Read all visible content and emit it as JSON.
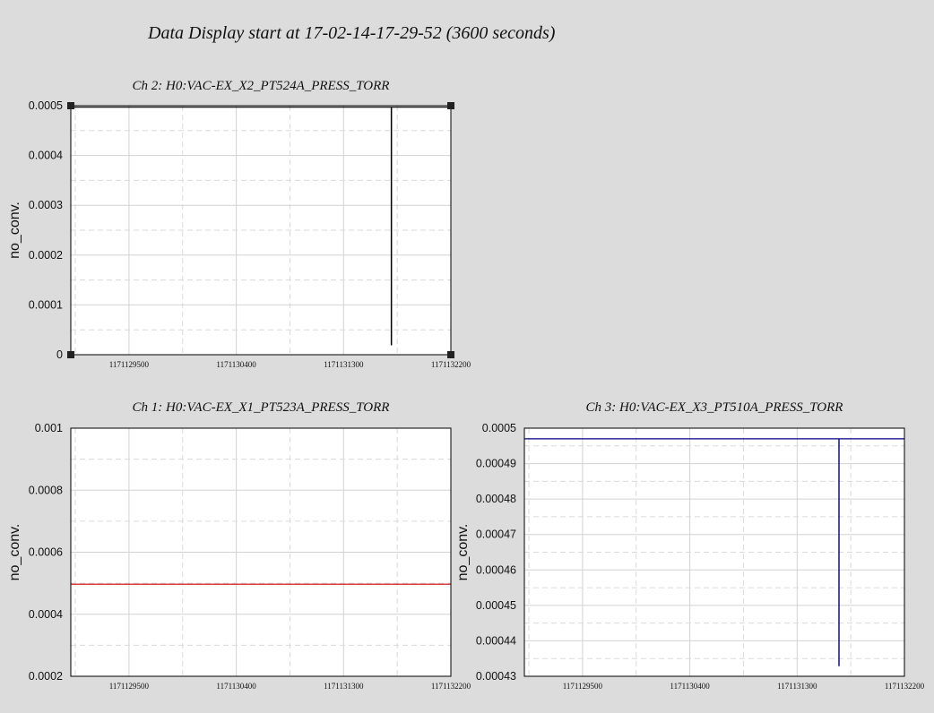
{
  "page": {
    "title": "Data Display start at 17-02-14-17-29-52 (3600 seconds)"
  },
  "chart_data": [
    {
      "id": "ch2",
      "type": "line",
      "title": "Ch 2: H0:VAC-EX_X2_PT524A_PRESS_TORR",
      "xlabel": "",
      "ylabel": "no_conv.",
      "xlim": [
        1171129012,
        1171132200
      ],
      "ylim": [
        0,
        0.0005
      ],
      "xticks": [
        1171129500,
        1171130400,
        1171131300,
        1171132200
      ],
      "xtick_labels": [
        "1171129500",
        "1171130400",
        "1171131300",
        "1171132200"
      ],
      "yticks": [
        0,
        0.0001,
        0.0002,
        0.0003,
        0.0004,
        0.0005
      ],
      "ytick_labels": [
        "0",
        "0.0001",
        "0.0002",
        "0.0003",
        "0.0004",
        "0.0005"
      ],
      "grid": true,
      "selected_corners": true,
      "series": [
        {
          "color": "#000000",
          "x": [
            1171129012,
            1171131700,
            1171131700,
            1171131702,
            1171131702,
            1171132200
          ],
          "y": [
            0.000497,
            0.000497,
            2e-05,
            2e-05,
            0.000497,
            0.000497
          ]
        }
      ]
    },
    {
      "id": "ch1",
      "type": "line",
      "title": "Ch 1: H0:VAC-EX_X1_PT523A_PRESS_TORR",
      "xlabel": "",
      "ylabel": "no_conv.",
      "xlim": [
        1171129012,
        1171132200
      ],
      "ylim": [
        0.0002,
        0.001
      ],
      "xticks": [
        1171129500,
        1171130400,
        1171131300,
        1171132200
      ],
      "xtick_labels": [
        "1171129500",
        "1171130400",
        "1171131300",
        "1171132200"
      ],
      "yticks": [
        0.0002,
        0.0004,
        0.0006,
        0.0008,
        0.001
      ],
      "ytick_labels": [
        "0.0002",
        "0.0004",
        "0.0006",
        "0.0008",
        "0.001"
      ],
      "grid": true,
      "selected_corners": false,
      "series": [
        {
          "color": "#cc0000",
          "x": [
            1171129012,
            1171132200
          ],
          "y": [
            0.000497,
            0.000497
          ]
        }
      ]
    },
    {
      "id": "ch3",
      "type": "line",
      "title": "Ch 3: H0:VAC-EX_X3_PT510A_PRESS_TORR",
      "xlabel": "",
      "ylabel": "no_conv.",
      "xlim": [
        1171129012,
        1171132200
      ],
      "ylim": [
        0.00043,
        0.0005
      ],
      "xticks": [
        1171129500,
        1171130400,
        1171131300,
        1171132200
      ],
      "xtick_labels": [
        "1171129500",
        "1171130400",
        "1171131300",
        "1171132200"
      ],
      "yticks": [
        0.00043,
        0.00044,
        0.00045,
        0.00046,
        0.00047,
        0.00048,
        0.00049,
        0.0005
      ],
      "ytick_labels": [
        "0.00043",
        "0.00044",
        "0.00045",
        "0.00046",
        "0.00047",
        "0.00048",
        "0.00049",
        "0.0005"
      ],
      "grid": true,
      "selected_corners": false,
      "series": [
        {
          "color": "#000080",
          "x": [
            1171129012,
            1171131650,
            1171131650,
            1171131652,
            1171131652,
            1171132200
          ],
          "y": [
            0.000497,
            0.000497,
            0.000433,
            0.000433,
            0.000497,
            0.000497
          ]
        }
      ]
    }
  ]
}
